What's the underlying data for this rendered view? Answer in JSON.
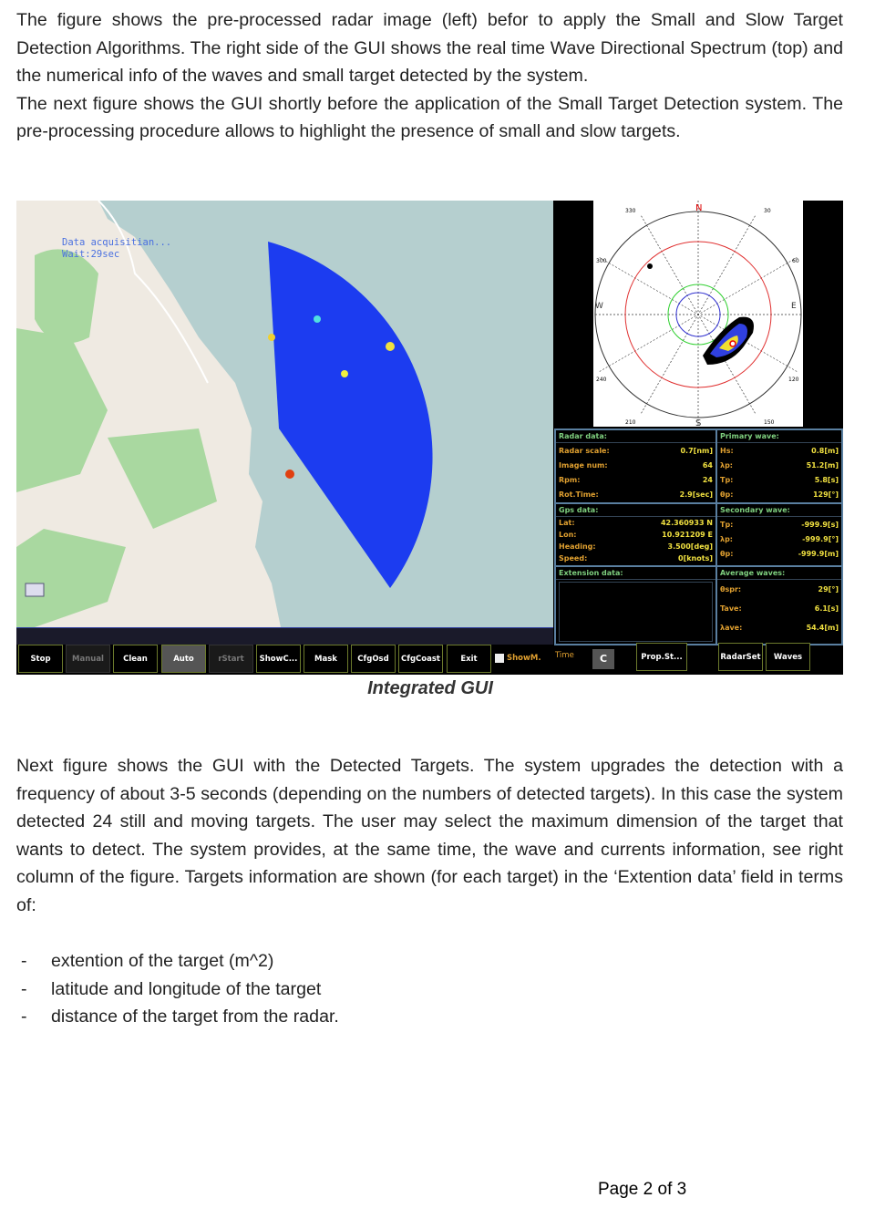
{
  "paragraphs_top": [
    "The figure shows the pre-processed radar image (left) befor to apply the Small and Slow Target Detection Algorithms. The right side of the GUI shows the real time Wave Directional Spectrum (top) and the numerical info of the waves and small target detected by the system.",
    "The next figure shows the GUI shortly before the application of the Small Target Detection system. The pre-processing procedure allows to highlight the presence of small and slow targets."
  ],
  "gui": {
    "map_overlay": {
      "line1": "Data acquisitian...",
      "line2": "Wait:29sec"
    },
    "polar": {
      "north": "N",
      "south": "S",
      "east": "E",
      "west": "W",
      "ticks": [
        "330",
        "30",
        "300",
        "60",
        "240",
        "120",
        "210",
        "150"
      ]
    },
    "radar_data": {
      "title": "Radar data:",
      "rows": [
        {
          "k": "Radar scale:",
          "v": "0.7[nm]"
        },
        {
          "k": "Image num:",
          "v": "64"
        },
        {
          "k": "Rpm:",
          "v": "24"
        },
        {
          "k": "Rot.Time:",
          "v": "2.9[sec]"
        }
      ]
    },
    "primary_wave": {
      "title": "Primary wave:",
      "rows": [
        {
          "k": "Hs:",
          "v": "0.8[m]"
        },
        {
          "k": "λp:",
          "v": "51.2[m]"
        },
        {
          "k": "Tp:",
          "v": "5.8[s]"
        },
        {
          "k": "θp:",
          "v": "129[°]"
        }
      ]
    },
    "gps_data": {
      "title": "Gps data:",
      "rows": [
        {
          "k": "Lat:",
          "v": "42.360933 N"
        },
        {
          "k": "Lon:",
          "v": "10.921209 E"
        },
        {
          "k": "Heading:",
          "v": "3.500[deg]"
        },
        {
          "k": "Speed:",
          "v": "0[knots]"
        }
      ]
    },
    "secondary_wave": {
      "title": "Secondary wave:",
      "rows": [
        {
          "k": "Tp:",
          "v": "-999.9[s]"
        },
        {
          "k": "λp:",
          "v": "-999.9[°]"
        },
        {
          "k": "θp:",
          "v": "-999.9[m]"
        }
      ]
    },
    "extension_data": {
      "title": "Extension data:"
    },
    "average_waves": {
      "title": "Average waves:",
      "rows": [
        {
          "k": "θspr:",
          "v": "29[°]"
        },
        {
          "k": "Tave:",
          "v": "6.1[s]"
        },
        {
          "k": "λave:",
          "v": "54.4[m]"
        }
      ]
    },
    "toolbar": {
      "buttons": [
        "Stop",
        "Manual",
        "Clean",
        "Auto",
        "rStart",
        "ShowC...",
        "Mask",
        "CfgOsd",
        "CfgCoast",
        "Exit"
      ],
      "checkbox_label": "ShowM.",
      "time_label": "Time",
      "time_value": "C",
      "right_buttons": [
        "Prop.St...",
        "RadarSet",
        "Waves"
      ]
    },
    "colors": {
      "accent": "#6c7a2c",
      "label": "#e0a030",
      "value": "#f0e040",
      "header": "#7fd07f"
    }
  },
  "caption": "Integrated GUI",
  "paragraph_mid": "Next figure shows the GUI with the Detected Targets. The system upgrades the detection with a frequency of about 3-5 seconds (depending on the numbers of detected targets). In this case the system detected 24 still and moving targets. The user may select the maximum dimension of the target that wants to detect. The system provides, at the same time, the wave and currents information, see right column of the figure. Targets information are shown (for each target) in the ‘Extention data’ field in terms of:",
  "bullets": [
    "extention of the target (m^2)",
    "latitude and longitude of the target",
    "distance of the target from the radar."
  ],
  "footer": "Page 2 of 3"
}
